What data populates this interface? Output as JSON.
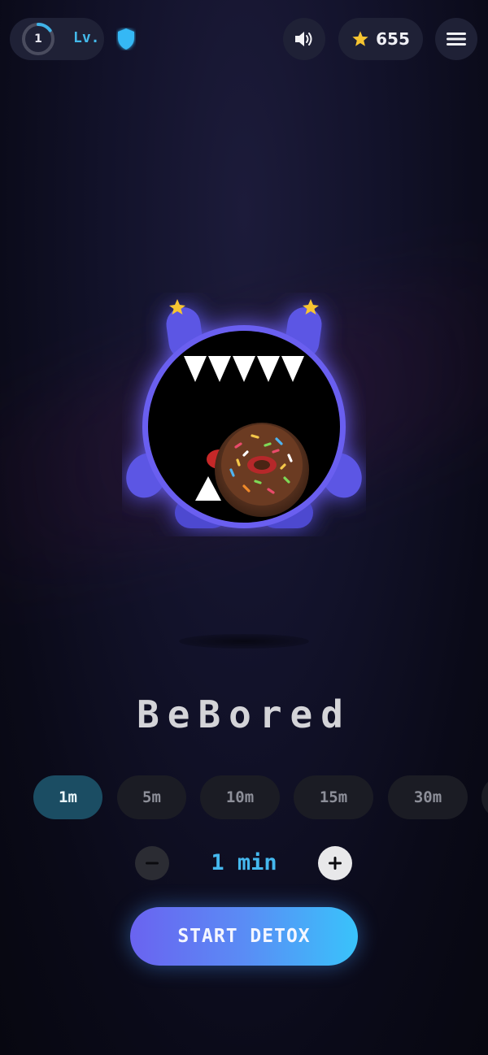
{
  "header": {
    "level": {
      "number": "1",
      "label": "Lv.",
      "progress": 0.15
    },
    "coins": "655",
    "icons": {
      "sound": "speaker-icon",
      "menu": "hamburger-menu-icon",
      "shield": "shield-icon",
      "star": "star-icon"
    }
  },
  "title": "BeBored",
  "durations": {
    "options": [
      "1m",
      "5m",
      "10m",
      "15m",
      "30m"
    ],
    "selected": "1m"
  },
  "stepper": {
    "value": "1 min"
  },
  "start_label": "START DETOX",
  "colors": {
    "accent": "#45b8ee",
    "monster": "#5b56e4",
    "button_start": "#6a63f0",
    "button_end": "#39c3fb",
    "chip_active": "#1b4d63"
  }
}
